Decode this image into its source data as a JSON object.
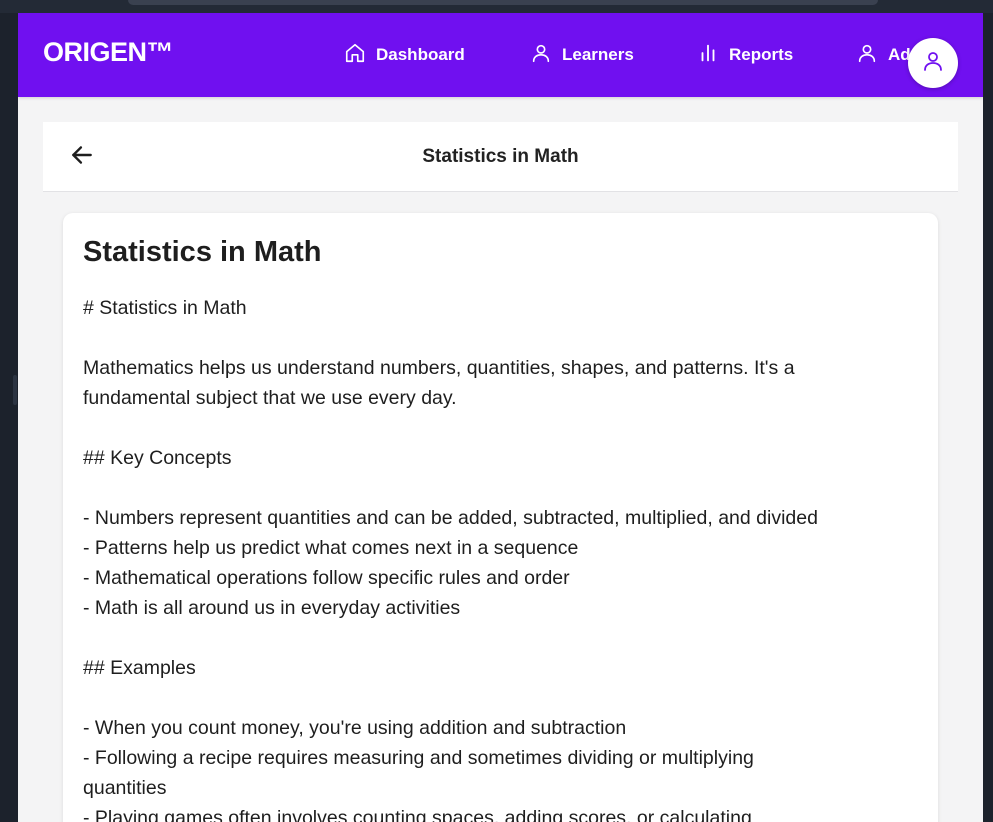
{
  "app": {
    "brand": "ORIGEN™"
  },
  "nav": {
    "items": [
      {
        "label": "Dashboard",
        "icon": "home-icon"
      },
      {
        "label": "Learners",
        "icon": "user-icon"
      },
      {
        "label": "Reports",
        "icon": "bar-chart-icon"
      },
      {
        "label": "Ad",
        "icon": "user-icon"
      }
    ]
  },
  "header": {
    "title": "Statistics in Math"
  },
  "content": {
    "title": "Statistics in Math",
    "lines": [
      "# Statistics in Math",
      "",
      "Mathematics helps us understand numbers, quantities, shapes, and patterns. It's a",
      "fundamental subject that we use every day.",
      "",
      "## Key Concepts",
      "",
      "- Numbers represent quantities and can be added, subtracted, multiplied, and divided",
      "- Patterns help us predict what comes next in a sequence",
      "- Mathematical operations follow specific rules and order",
      "- Math is all around us in everyday activities",
      "",
      "## Examples",
      "",
      "- When you count money, you're using addition and subtraction",
      "- Following a recipe requires measuring and sometimes dividing or multiplying",
      "quantities",
      "- Playing games often involves counting spaces, adding scores, or calculating"
    ]
  },
  "colors": {
    "brand": "#7010f0",
    "background": "#f4f4f5",
    "card": "#ffffff",
    "text": "#1e1e1e"
  }
}
